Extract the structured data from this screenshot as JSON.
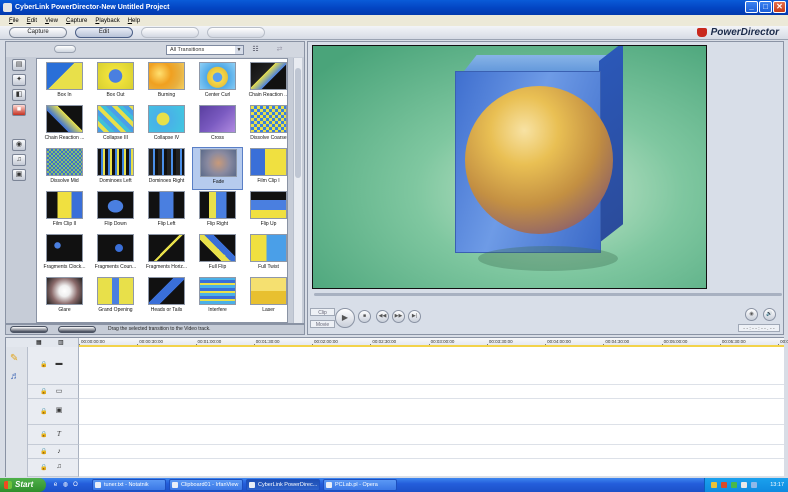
{
  "window": {
    "title": "CyberLink PowerDirector-New Untitled Project",
    "buttons": [
      "_",
      "□",
      "✕"
    ]
  },
  "menu": [
    "File",
    "Edit",
    "View",
    "Capture",
    "Playback",
    "Help"
  ],
  "modes": {
    "capture": "Capture",
    "edit": "Edit",
    "produce": "",
    "create_disc": ""
  },
  "brand": "PowerDirector",
  "library": {
    "filter": "All Transitions",
    "status_message": "Drag the selected transition to the Video track.",
    "selected": "Fade",
    "transitions": [
      {
        "label": "Box In",
        "style": "boxin"
      },
      {
        "label": "Box Out",
        "style": "boxout"
      },
      {
        "label": "Burning",
        "style": "burning"
      },
      {
        "label": "Center Curl",
        "style": "curl"
      },
      {
        "label": "Chain Reaction ...",
        "style": "chain1"
      },
      {
        "label": "Chain Reaction ...",
        "style": "chain2"
      },
      {
        "label": "Collapse III",
        "style": "collapse3"
      },
      {
        "label": "Collapse IV",
        "style": "collapse4"
      },
      {
        "label": "Cross",
        "style": "cross"
      },
      {
        "label": "Dissolve Coarse",
        "style": "dcoarse"
      },
      {
        "label": "Dissolve Mid",
        "style": "dmid"
      },
      {
        "label": "Dominoes Left",
        "style": "domleft"
      },
      {
        "label": "Dominoes Right",
        "style": "domright"
      },
      {
        "label": "Fade",
        "style": "fade"
      },
      {
        "label": "Film Clip I",
        "style": "film1"
      },
      {
        "label": "Film Clip II",
        "style": "film2"
      },
      {
        "label": "Flip Down",
        "style": "flipdown"
      },
      {
        "label": "Flip Left",
        "style": "flipleft"
      },
      {
        "label": "Flip Right",
        "style": "flipright"
      },
      {
        "label": "Flip Up",
        "style": "flipup"
      },
      {
        "label": "Fragments Clock...",
        "style": "frag1"
      },
      {
        "label": "Fragments Coun...",
        "style": "frag2"
      },
      {
        "label": "Fragments Horiz...",
        "style": "frag3"
      },
      {
        "label": "Full Flip",
        "style": "fullflip"
      },
      {
        "label": "Full Twist",
        "style": "fulltwist"
      },
      {
        "label": "Glare",
        "style": "glare"
      },
      {
        "label": "Grand Opening",
        "style": "grand"
      },
      {
        "label": "Heads or Tails",
        "style": "heads"
      },
      {
        "label": "Interfere",
        "style": "interfere"
      },
      {
        "label": "Laser",
        "style": "laser"
      }
    ]
  },
  "preview": {
    "clip_label": "Clip",
    "movie_label": "Movie",
    "timecode": "- - : - - : - - . - -"
  },
  "timeline": {
    "ticks": [
      "00:00:00:00",
      "00:00:30:00",
      "00:01:00:00",
      "00:01:30:00",
      "00:02:00:00",
      "00:02:30:00",
      "00:03:00:00",
      "00:03:30:00",
      "00:04:00:00",
      "00:04:30:00",
      "00:05:00:00",
      "00:05:30:00",
      "00:06:00:00"
    ]
  },
  "taskbar": {
    "start": "Start",
    "tasks": [
      {
        "label": "tuner.txt - Notatnik",
        "active": false
      },
      {
        "label": "Clipboard01 - IrfanView",
        "active": false
      },
      {
        "label": "CyberLink PowerDirec...",
        "active": true
      },
      {
        "label": "PCLab.pl - Opera",
        "active": false
      }
    ],
    "clock": "13:17"
  }
}
